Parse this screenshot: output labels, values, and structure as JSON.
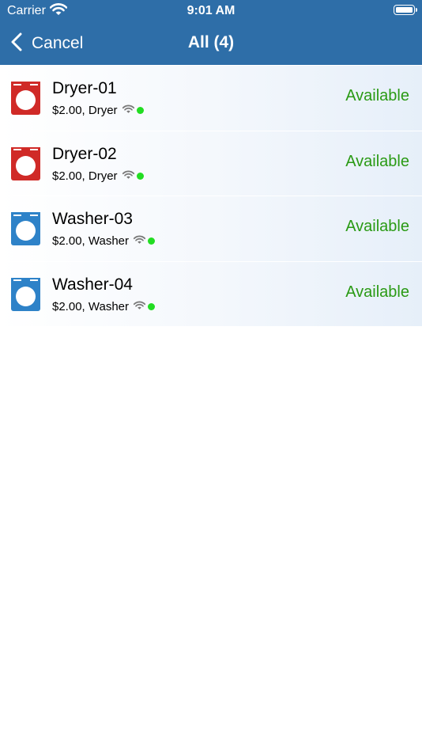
{
  "status_bar": {
    "carrier": "Carrier",
    "time": "9:01 AM"
  },
  "nav": {
    "back_label": "Cancel",
    "title": "All (4)"
  },
  "colors": {
    "header": "#2e6ea8",
    "dryer": "#d02a27",
    "washer": "#2e82c8",
    "available": "#2a9a14",
    "online": "#22dd22",
    "wifi": "#7a7a7a"
  },
  "devices": [
    {
      "name": "Dryer-01",
      "subtitle": "$2.00, Dryer",
      "status": "Available",
      "kind": "dryer"
    },
    {
      "name": "Dryer-02",
      "subtitle": "$2.00, Dryer",
      "status": "Available",
      "kind": "dryer"
    },
    {
      "name": "Washer-03",
      "subtitle": "$2.00, Washer",
      "status": "Available",
      "kind": "washer"
    },
    {
      "name": "Washer-04",
      "subtitle": "$2.00, Washer",
      "status": "Available",
      "kind": "washer"
    }
  ]
}
